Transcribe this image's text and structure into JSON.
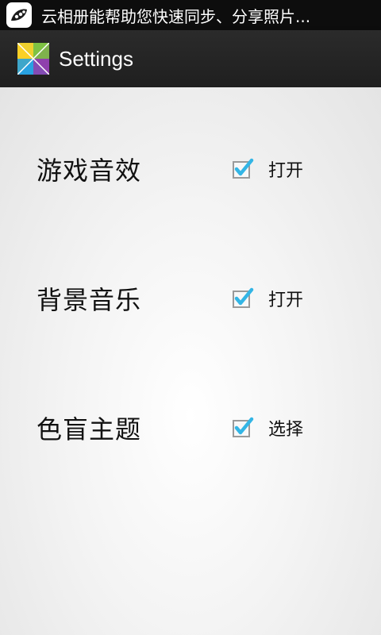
{
  "status_bar": {
    "notification_icon": "peapod-app-icon",
    "notification_text": "云相册能帮助您快速同步、分享照片..."
  },
  "action_bar": {
    "app_icon": "colorful-squares-app-icon",
    "title": "Settings"
  },
  "settings": [
    {
      "label": "游戏音效",
      "option_label": "打开",
      "checked": true
    },
    {
      "label": "背景音乐",
      "option_label": "打开",
      "checked": true
    },
    {
      "label": "色盲主题",
      "option_label": "选择",
      "checked": true
    }
  ],
  "colors": {
    "status_bar_bg": "#0d0d0d",
    "action_bar_bg": "#242424",
    "checkmark": "#33b5e5",
    "text": "#111111"
  }
}
